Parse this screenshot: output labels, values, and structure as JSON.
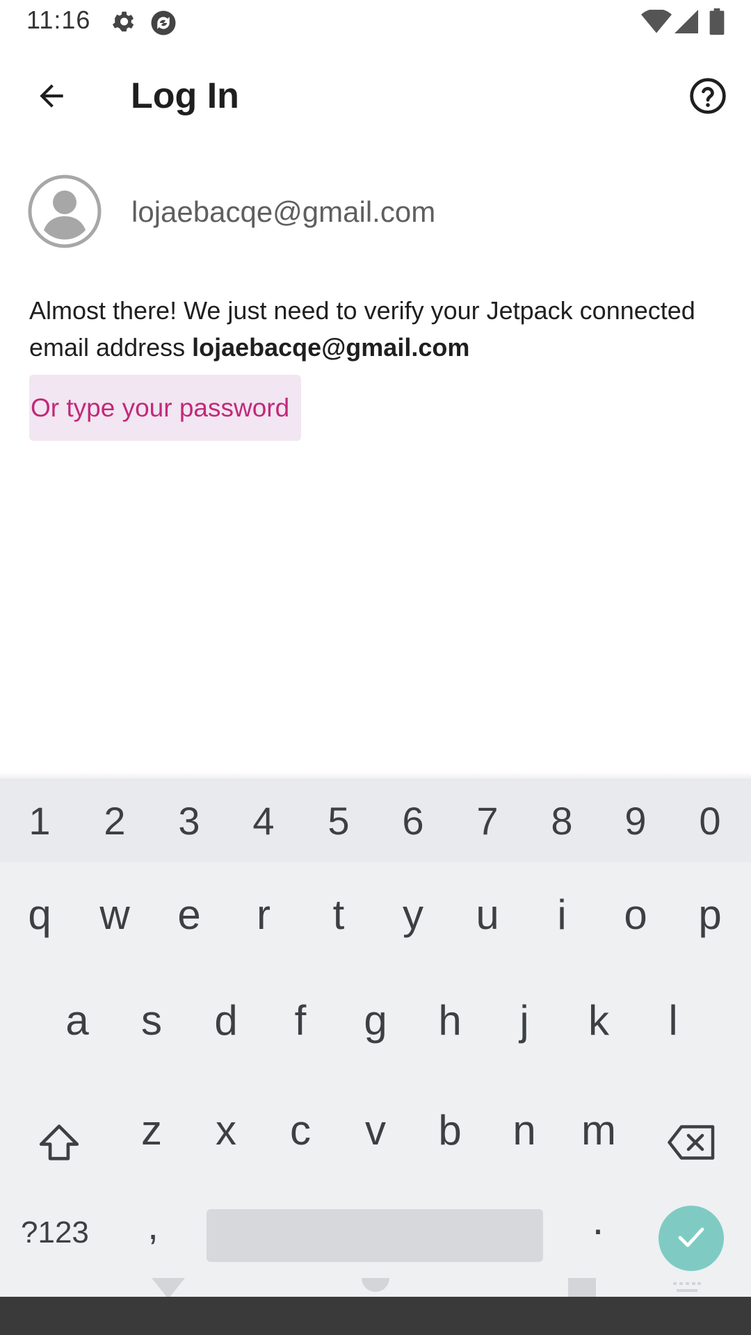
{
  "status_bar": {
    "time": "11:16"
  },
  "app_bar": {
    "title": "Log In"
  },
  "account": {
    "email": "lojaebacqe@gmail.com"
  },
  "message": {
    "text": "Almost there! We just need to verify your Jetpack connected email address ",
    "email": "lojaebacqe@gmail.com"
  },
  "password_button": {
    "label": "Or type your password"
  },
  "keyboard": {
    "numbers": [
      "1",
      "2",
      "3",
      "4",
      "5",
      "6",
      "7",
      "8",
      "9",
      "0"
    ],
    "row1": [
      "q",
      "w",
      "e",
      "r",
      "t",
      "y",
      "u",
      "i",
      "o",
      "p"
    ],
    "row2": [
      "a",
      "s",
      "d",
      "f",
      "g",
      "h",
      "j",
      "k",
      "l"
    ],
    "row3": [
      "z",
      "x",
      "c",
      "v",
      "b",
      "n",
      "m"
    ],
    "symbols_label": "?123",
    "comma": ",",
    "period": "."
  },
  "colors": {
    "accent": "#c2297a",
    "button_bg": "#f1e6f1",
    "enter_key": "#7fcbc4",
    "keyboard_bg": "#eef0f2"
  },
  "icons": {
    "status": [
      "settings-icon",
      "sync-icon",
      "wifi-icon",
      "signal-icon",
      "battery-icon"
    ],
    "app_bar": [
      "back-arrow-icon",
      "help-icon"
    ],
    "keyboard": [
      "shift-icon",
      "backspace-icon",
      "check-icon"
    ],
    "nav": [
      "nav-back-icon",
      "nav-home-icon",
      "nav-recents-icon",
      "keyboard-switch-icon"
    ]
  }
}
